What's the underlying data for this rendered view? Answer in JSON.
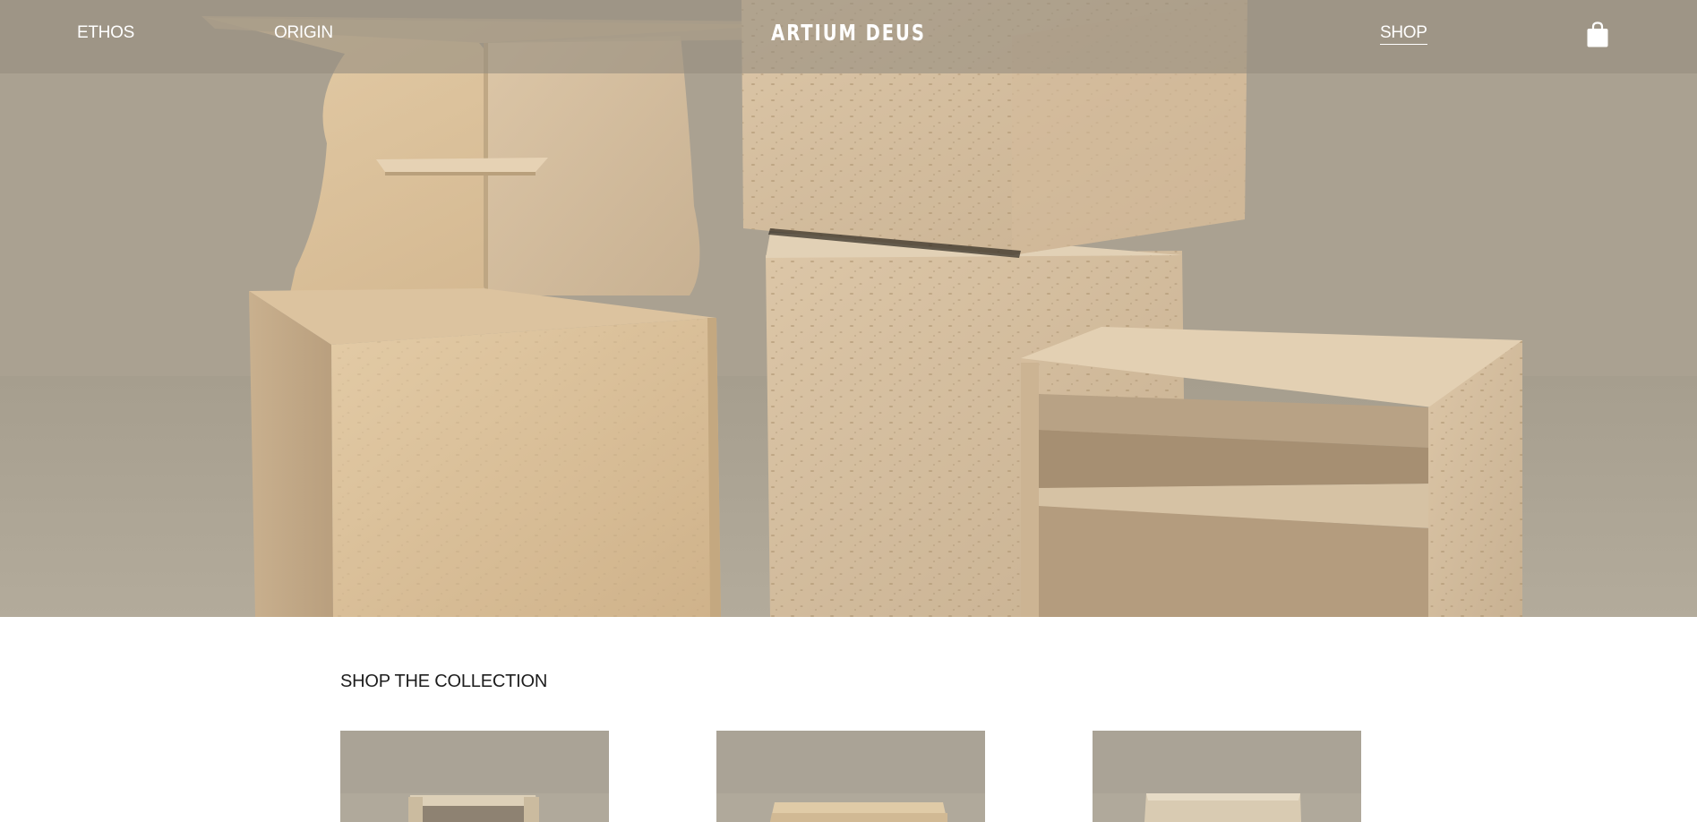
{
  "nav": {
    "links": [
      {
        "label": "ETHOS"
      },
      {
        "label": "ORIGIN"
      },
      {
        "label": "SHOP",
        "active": true
      }
    ],
    "brand": "ARTIUM DEUS",
    "cart_icon": "shopping-bag-icon"
  },
  "hero": {
    "image": "travertine-furniture-pieces"
  },
  "collection": {
    "title": "SHOP THE COLLECTION",
    "products": [
      {
        "image": "travertine-side-table"
      },
      {
        "image": "travertine-bench"
      },
      {
        "image": "travertine-cube-table"
      }
    ]
  },
  "colors": {
    "nav_overlay": "#968e80",
    "stone": "#d9c3a2",
    "backdrop": "#aaa191",
    "text_dark": "#1d1d1d",
    "text_light": "#ffffff"
  }
}
